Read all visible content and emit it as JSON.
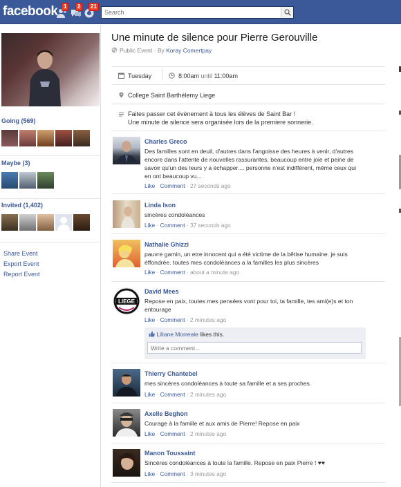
{
  "topbar": {
    "logo": "facebook",
    "friend_requests_count": "1",
    "messages_count": "2",
    "notifications_count": "21",
    "search_placeholder": "Search"
  },
  "left": {
    "going_label": "Going (569)",
    "maybe_label": "Maybe (3)",
    "invited_label": "Invited (1,402)",
    "links": [
      "Share Event",
      "Export Event",
      "Report Event"
    ]
  },
  "event": {
    "title": "Une minute de silence pour Pierre Gerouville",
    "visibility": "Public Event",
    "by_prefix": "· By",
    "host": "Koray Comertpay",
    "day": "Tuesday",
    "time_start": "8:00am",
    "time_until": "until",
    "time_end": "11:00am",
    "location": "College Saint Barthélemy Liege",
    "description_1": "Faites passer cet évènement à tous les élèves de Saint Bar !",
    "description_2": "Une minute de silence sera organisée lors de la premiere sonnerie."
  },
  "actions": {
    "like": "Like",
    "comment": "Comment",
    "sep": "·"
  },
  "comments": [
    {
      "name": "Charles Greco",
      "lines": [
        "Des familles sont en deuil, d'autres dans l'angoisse des heures à venir, d'autres",
        "encore dans l'attente de nouvelles rassurantes, beaucoup entre joie et peine de",
        "savoir qu'un des leurs y a échapper.... personne n'est indifférent, même ceux qui",
        "en ont beaucoup vu..."
      ],
      "time": "27 seconds ago"
    },
    {
      "name": "Linda Ison",
      "lines": [
        "sincères condoléances"
      ],
      "time": "37 seconds ago"
    },
    {
      "name": "Nathalie Ghizzi",
      "lines": [
        "pauvre gamin, un etre innocent qui a été victime de la bêtise humaine. je suis",
        "éffondrée. toutes mes condoléances a la familles les plus sincères"
      ],
      "time": "about a minute ago"
    },
    {
      "name": "David Mees",
      "lines": [
        "Repose en paix, toutes mes pensées vont pour toi, ta famille, tes ami(e)s et ton",
        "entourage"
      ],
      "time": "2 minutes ago",
      "avatar_text": "LIEGE"
    },
    {
      "name": "Thierry Chantebel",
      "lines": [
        "mes sincères condoléances à toute sa famille et a ses proches."
      ],
      "time": "2 minutes ago"
    },
    {
      "name": "Axelle Beghon",
      "lines": [
        "Courage à la famille et aux amis de Pierre! Repose en paix"
      ],
      "time": "2 minutes ago"
    },
    {
      "name": "Manon Toussaint",
      "lines": [
        "Sincères condoléances à toute la famille. Repose en paix Pierre ! ♥♥"
      ],
      "time": "3 minutes ago"
    }
  ],
  "likes_box": {
    "liker": "Liliane Morreale",
    "likes_suffix": "likes this.",
    "write_placeholder": "Write a comment..."
  },
  "colors": {
    "brand": "#3b5998",
    "badge": "#f03d25"
  }
}
